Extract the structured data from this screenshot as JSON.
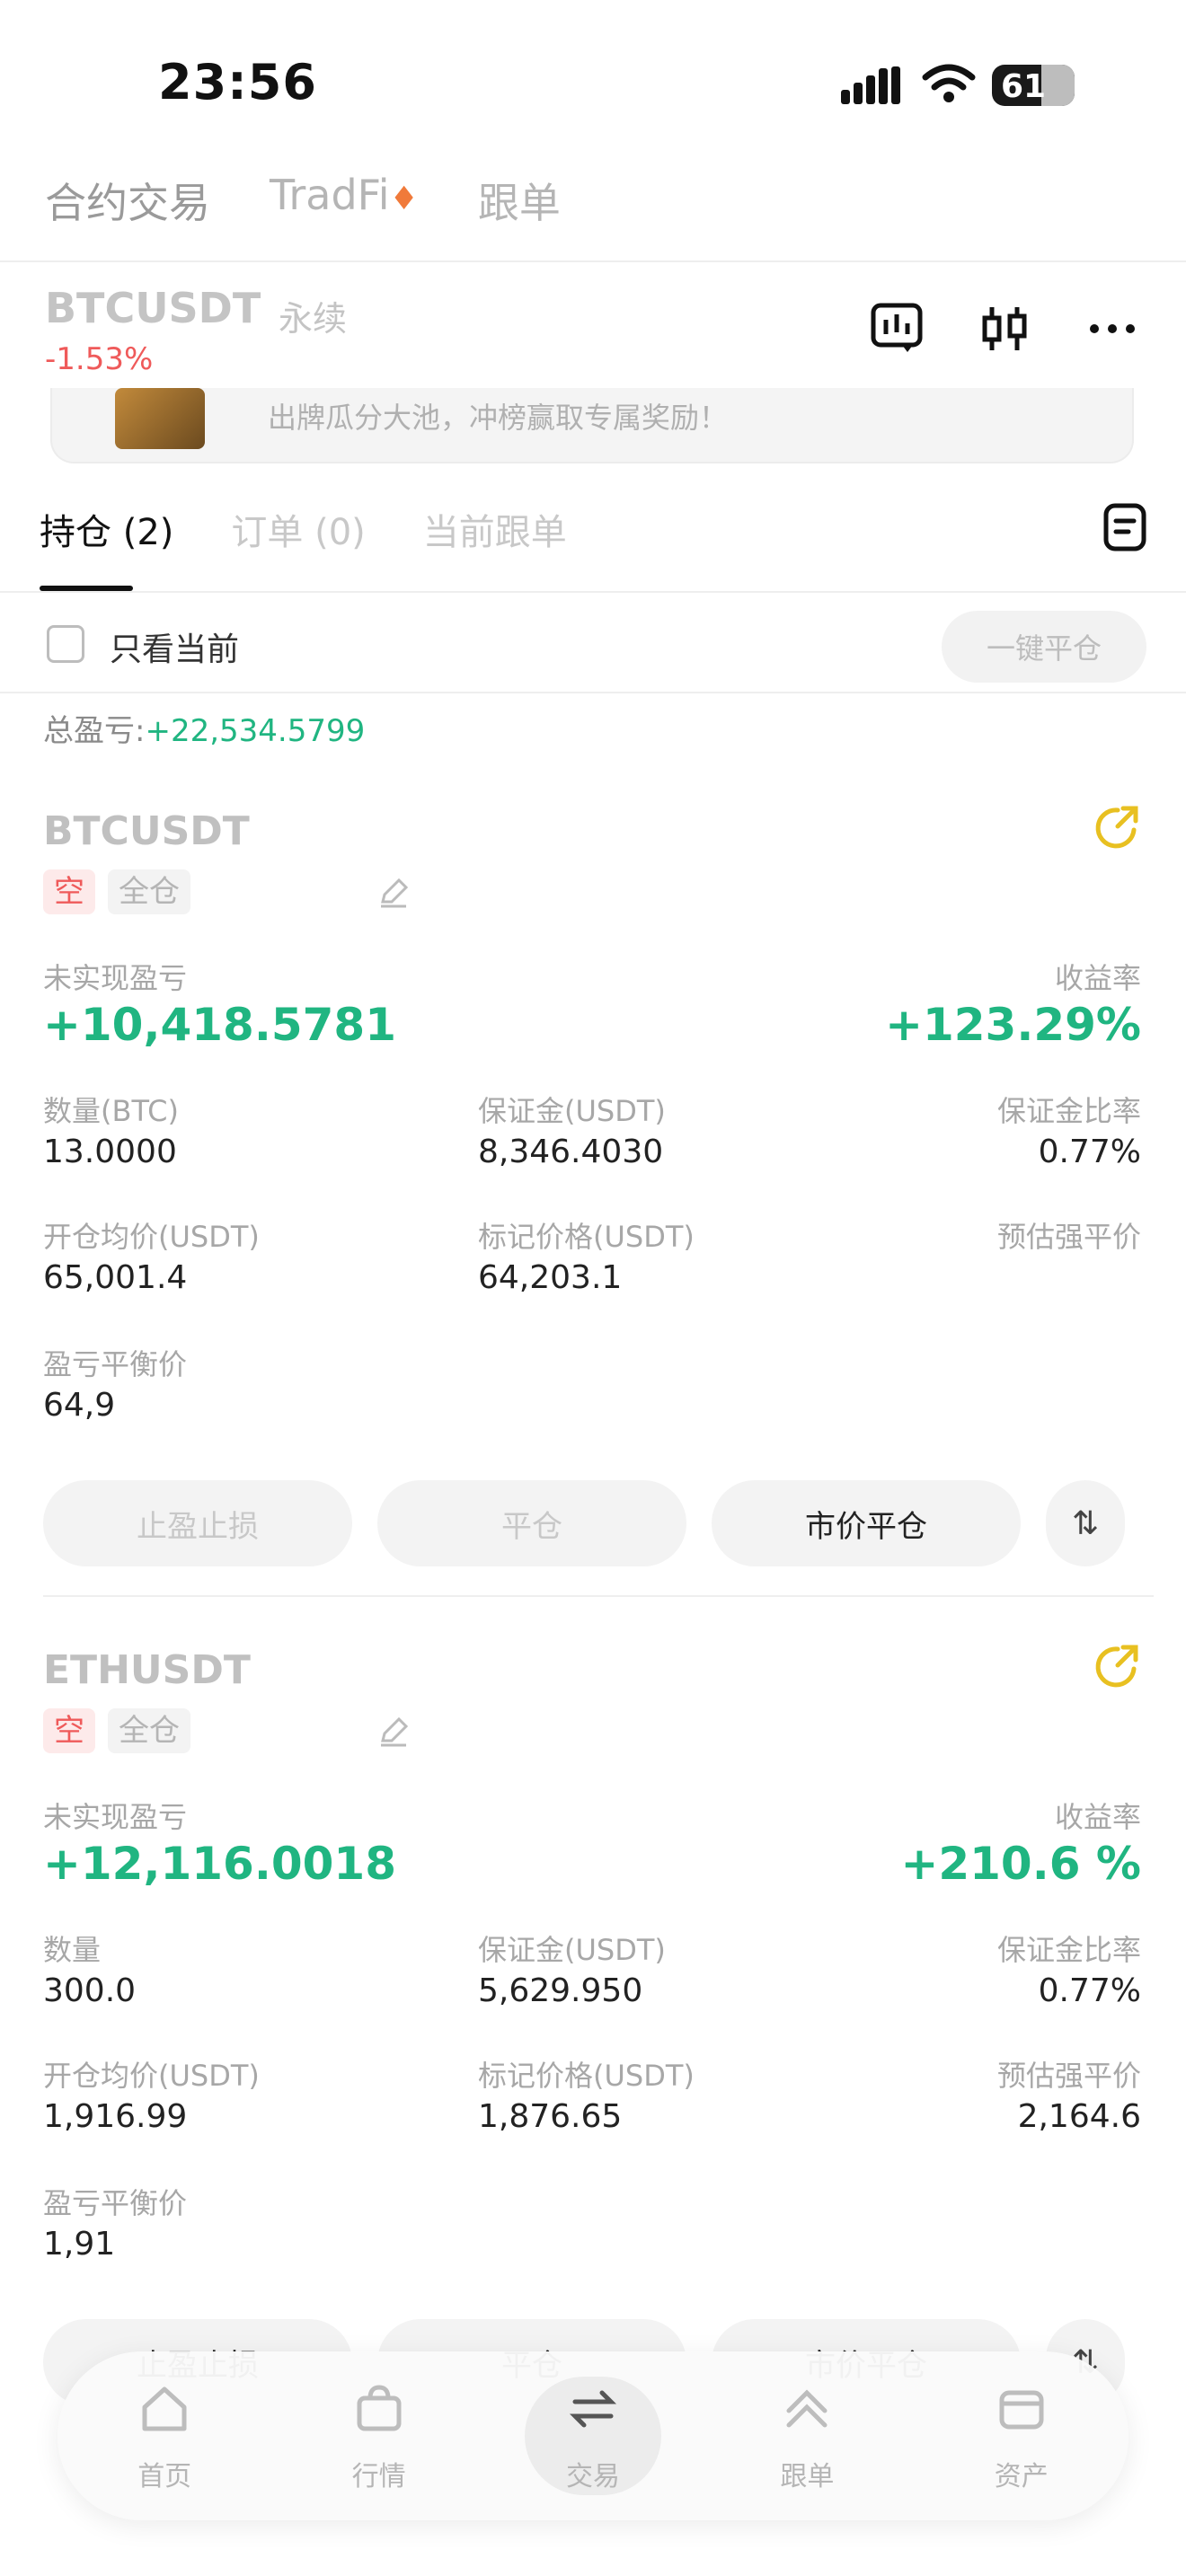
{
  "status_bar": {
    "time": "23:56",
    "battery": "61"
  },
  "top_tabs": [
    {
      "label": "合约交易"
    },
    {
      "label": "TradFi"
    },
    {
      "label": "跟单"
    }
  ],
  "symbol": {
    "name": "BTCUSDT",
    "type": "永续",
    "change": "-1.53%"
  },
  "banner": {
    "text": "出牌瓜分大池，冲榜赢取专属奖励！"
  },
  "position_tabs": [
    {
      "label": "持仓 (2)"
    },
    {
      "label": "订单 (0)"
    },
    {
      "label": "当前跟单"
    }
  ],
  "filter": {
    "label": "只看当前",
    "close_all": "一键平仓"
  },
  "total_pnl": {
    "label": "总盈亏:",
    "value": "+22,534.5799"
  },
  "positions": [
    {
      "title": "BTCUSDT",
      "side": "空",
      "mode": "全仓",
      "unrealized_label": "未实现盈亏",
      "unrealized": "+10,418.5781",
      "roi_label": "收益率",
      "roi": "+123.29%",
      "qty_label": "数量(BTC)",
      "qty": "13.0000",
      "margin_label": "保证金(USDT)",
      "margin": "8,346.4030",
      "margin_ratio_label": "保证金比率",
      "margin_ratio": "0.77%",
      "entry_label": "开仓均价(USDT)",
      "entry": "65,001.4",
      "mark_label": "标记价格(USDT)",
      "mark": "64,203.1",
      "liq_label": "预估强平价",
      "liq": "",
      "be_label": "盈亏平衡价",
      "be": "64,9",
      "actions": [
        "止盈止损",
        "平仓",
        "市价平仓"
      ]
    },
    {
      "title": "ETHUSDT",
      "side": "空",
      "mode": "全仓",
      "unrealized_label": "未实现盈亏",
      "unrealized": "+12,116.0018",
      "roi_label": "收益率",
      "roi": "+210.6 %",
      "qty_label": "数量",
      "qty": "300.0",
      "margin_label": "保证金(USDT)",
      "margin": "5,629.950",
      "margin_ratio_label": "保证金比率",
      "margin_ratio": "0.77%",
      "entry_label": "开仓均价(USDT)",
      "entry": "1,916.99",
      "mark_label": "标记价格(USDT)",
      "mark": "1,876.65",
      "liq_label": "预估强平价",
      "liq": "2,164.6",
      "be_label": "盈亏平衡价",
      "be": "1,91",
      "actions": [
        "止盈止损",
        "平仓",
        "市价平仓"
      ]
    }
  ],
  "bottom_nav": [
    {
      "label": "首页",
      "icon": "home-icon"
    },
    {
      "label": "行情",
      "icon": "market-icon"
    },
    {
      "label": "交易",
      "icon": "trade-icon"
    },
    {
      "label": "跟单",
      "icon": "copy-icon"
    },
    {
      "label": "资产",
      "icon": "wallet-icon"
    }
  ],
  "colors": {
    "green": "#20b581",
    "red": "#ef5a5a",
    "accent": "#f0c419"
  }
}
